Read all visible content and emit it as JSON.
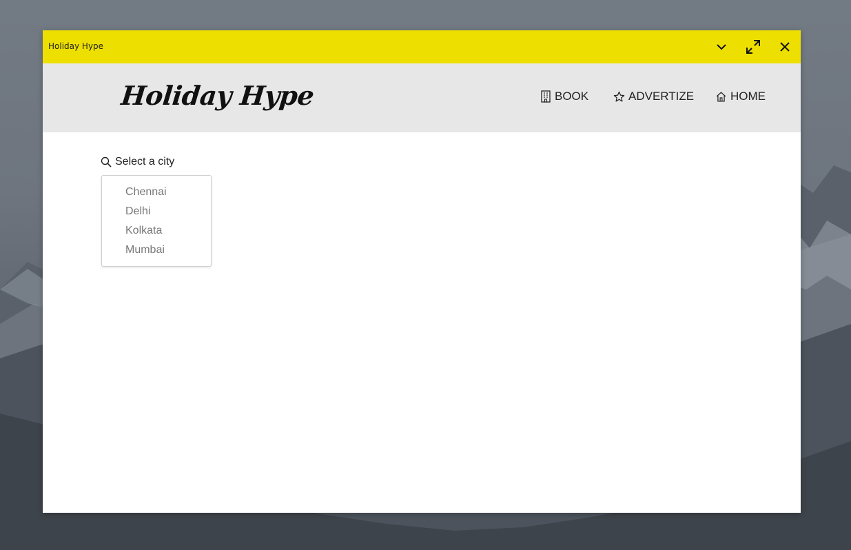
{
  "window": {
    "title": "Holiday Hype"
  },
  "titlebar_buttons": {
    "dropdown_icon": "chevron-down-icon",
    "maximize_icon": "expand-icon",
    "close_icon": "close-icon"
  },
  "header": {
    "logo_text": "Holiday Hype",
    "nav": [
      {
        "label": "BOOK",
        "icon": "building-icon"
      },
      {
        "label": "ADVERTIZE",
        "icon": "star-icon"
      },
      {
        "label": "HOME",
        "icon": "home-icon"
      }
    ]
  },
  "main": {
    "city_label": "Select a city",
    "city_label_icon": "search-icon",
    "cities": [
      "Chennai",
      "Delhi",
      "Kolkata",
      "Mumbai"
    ]
  },
  "colors": {
    "titlebar": "#ede000",
    "header_bg": "#e7e7e7",
    "content_bg": "#ffffff",
    "city_text": "#777777"
  }
}
